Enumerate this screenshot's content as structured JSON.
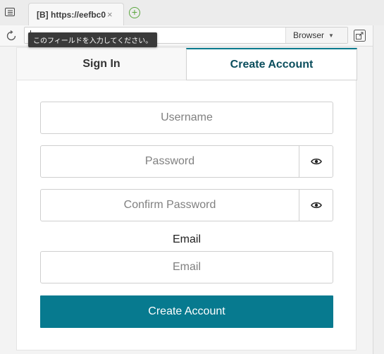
{
  "browser": {
    "tab_title": "[B] https://eefbc0",
    "tab_close": "×",
    "new_tab": "+",
    "browser_select": "Browser",
    "tooltip": "このフィールドを入力してください。"
  },
  "form": {
    "tabs": [
      "Sign In",
      "Create Account"
    ],
    "active_tab": "Create Account",
    "username_placeholder": "Username",
    "password_placeholder": "Password",
    "confirm_placeholder": "Confirm Password",
    "email_label": "Email",
    "email_placeholder": "Email",
    "submit_label": "Create Account"
  },
  "colors": {
    "accent": "#077a8f",
    "active_tab_text": "#0b4e5d"
  }
}
